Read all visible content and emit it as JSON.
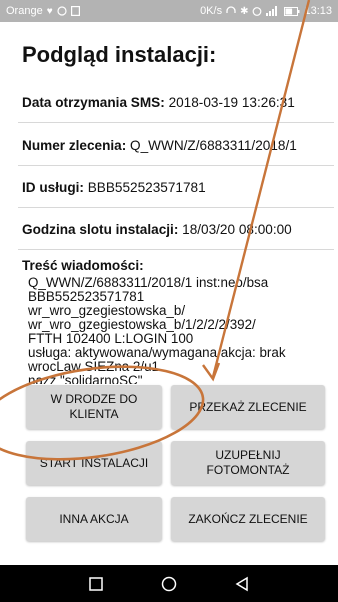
{
  "status_bar": {
    "carrier": "Orange",
    "speed": "0K/s",
    "time": "13:13",
    "battery_level": 0.6
  },
  "title": "Podgląd instalacji:",
  "fields": [
    {
      "label": "Data otrzymania SMS:",
      "value": "2018-03-19 13:26:31"
    },
    {
      "label": "Numer zlecenia:",
      "value": "Q_WWN/Z/6883311/2018/1"
    },
    {
      "label": "ID usługi:",
      "value": "BBB552523571781"
    },
    {
      "label": "Godzina slotu instalacji:",
      "value": "18/03/20 08:00:00"
    }
  ],
  "message": {
    "label": "Treść wiadomości:",
    "lines": [
      "Q_WWN/Z/6883311/2018/1 inst:neo/bsa",
      "BBB552523571781",
      "wr_wro_gzegiestowska_b/",
      "wr_wro_gzegiestowska_b/1/2/2/2/392/",
      "FTTH 102400 L:LOGIN 100",
      "usługa: aktywowana/wymagana akcja: brak",
      "wrocLaw SIEZna 2/u1",
      "nazz \"solidarnoSC\""
    ]
  },
  "buttons": {
    "on_the_way": "W DRODZE DO KLIENTA",
    "forward_order": "PRZEKAŻ ZLECENIE",
    "start_install": "START INSTALACJI",
    "photo_montage": "UZUPEŁNIJ FOTOMONTAŻ",
    "other_action": "INNA AKCJA",
    "close_order": "ZAKOŃCZ ZLECENIE"
  },
  "colors": {
    "annotation": "#c8753a",
    "button_bg": "#d6d6d6",
    "status_bar": "#b3b3b3",
    "nav_bar": "#000000"
  }
}
